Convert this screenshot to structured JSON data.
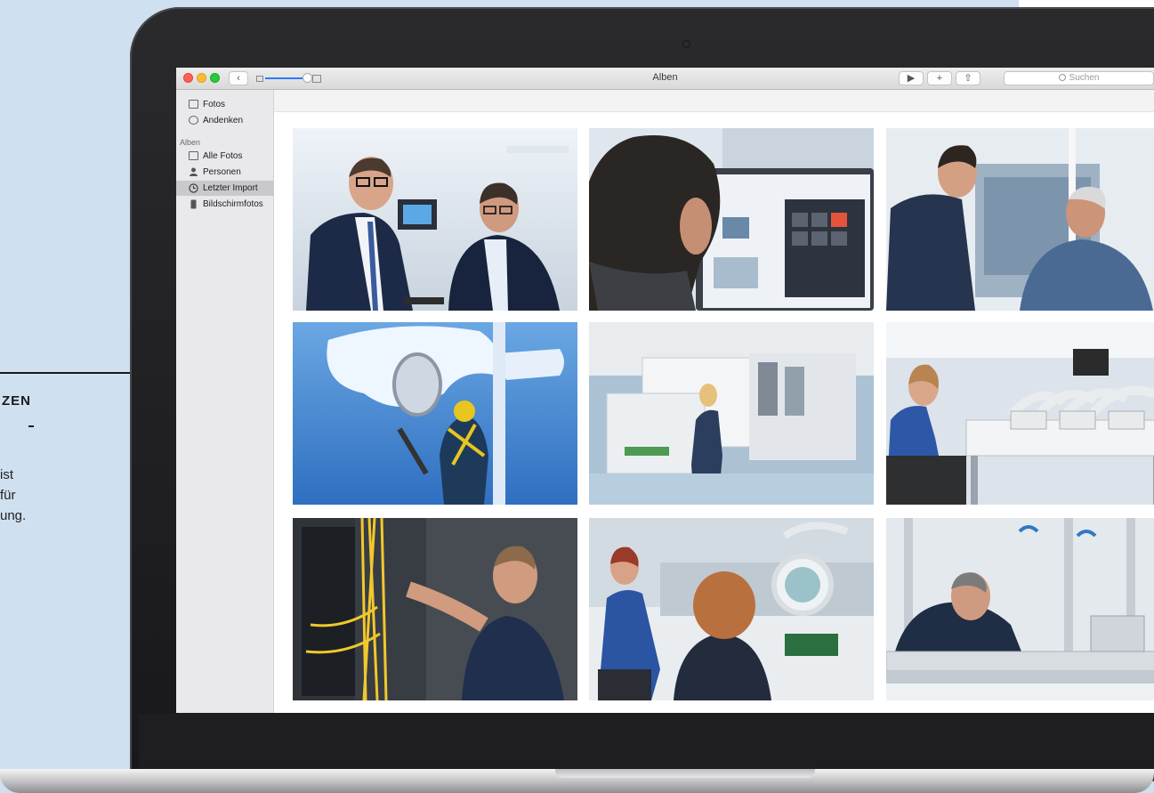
{
  "page": {
    "heading": "ZEN",
    "body_lines": "ist\nfür\nung."
  },
  "app": {
    "window_title": "Alben",
    "back_glyph": "‹",
    "play_glyph": "▶",
    "add_glyph": "+",
    "share_glyph": "⇧",
    "search_placeholder": "Suchen"
  },
  "sidebar": {
    "top_items": [
      {
        "label": "Fotos",
        "icon": "photos-icon"
      },
      {
        "label": "Andenken",
        "icon": "memories-icon"
      }
    ],
    "section_label": "Alben",
    "album_items": [
      {
        "label": "Alle Fotos",
        "icon": "all-photos-icon"
      },
      {
        "label": "Personen",
        "icon": "person-icon"
      },
      {
        "label": "Letzter Import",
        "icon": "clock-icon",
        "selected": true
      },
      {
        "label": "Bildschirmfotos",
        "icon": "screenshot-icon"
      }
    ]
  },
  "photos": [
    {
      "subject": "Two businessmen in suits talking in a bright office"
    },
    {
      "subject": "Man looking at a touchscreen monitor interface"
    },
    {
      "subject": "Two men in suits viewing a large display"
    },
    {
      "subject": "Technician climbing an icy mast with a spotlight"
    },
    {
      "subject": "Worker at a white production machine in a factory hall"
    },
    {
      "subject": "Woman working at an electronics workbench"
    },
    {
      "subject": "Technician patching yellow fiber cables in a server rack"
    },
    {
      "subject": "Employees inspecting circuit boards with a magnifier lamp"
    },
    {
      "subject": "Man assembling an aluminium profile machine"
    }
  ]
}
